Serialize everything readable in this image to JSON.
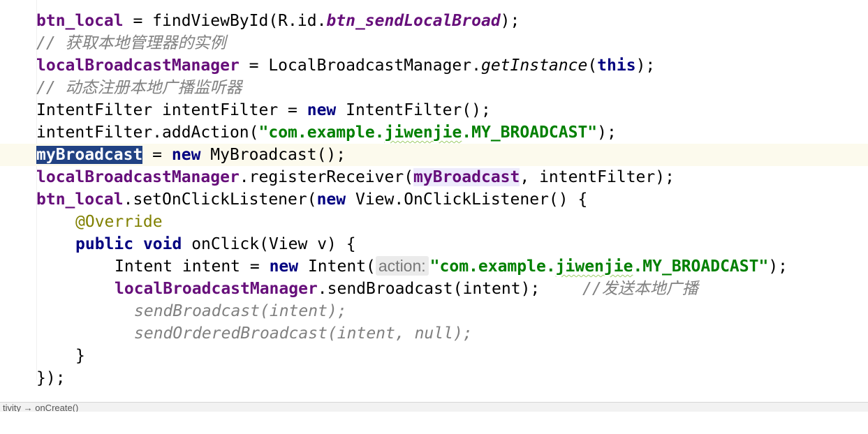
{
  "editor": {
    "lines": {
      "l1": {
        "a": "btn_local",
        "b": " = findViewById(R.id.",
        "c": "btn_sendLocalBroad",
        "d": ");"
      },
      "l2": {
        "comment": "// 获取本地管理器的实例"
      },
      "l3": {
        "a": "localBroadcastManager",
        "b": " = LocalBroadcastManager.",
        "c": "getInstance",
        "d": "(",
        "e": "this",
        "f": ");"
      },
      "l4": {
        "comment": "// 动态注册本地广播监听器"
      },
      "l5": {
        "a": "IntentFilter intentFilter = ",
        "b": "new",
        "c": " IntentFilter();"
      },
      "l6": {
        "a": "intentFilter.addAction(",
        "b1": "\"com.example.",
        "b2": "jiwenjie",
        "b3": ".MY_BROADCAST\"",
        "c": ");"
      },
      "l7": {
        "a": "myBroadcast",
        "b": " = ",
        "c": "new",
        "d": " MyBroadcast();"
      },
      "l8": {
        "a": "localBroadcastManager",
        "b": ".registerReceiver(",
        "c": "myBroadcast",
        "d": ", intentFilter);"
      },
      "l9": {
        "a": "btn_local",
        "b": ".setOnClickListener(",
        "c": "new",
        "d": " View.OnClickListener() {"
      },
      "l10": {
        "a": "@Override"
      },
      "l11": {
        "a": "public",
        "b": " ",
        "c": "void",
        "d": " onClick(View v) {"
      },
      "l12": {
        "a": "Intent intent = ",
        "b": "new",
        "c": " Intent(",
        "hint": "action:",
        "d1": "\"com.example.",
        "d2": "jiwenjie",
        "d3": ".MY_BROADCAST\"",
        "e": ");"
      },
      "l13": {
        "a": "localBroadcastManager",
        "b": ".sendBroadcast(intent);",
        "comment": "//发送本地广播"
      },
      "l14": {
        "comment": "sendBroadcast(intent);"
      },
      "l15": {
        "comment": "sendOrderedBroadcast(intent, null);"
      },
      "l16": {
        "a": "}"
      },
      "l17": {
        "a": "});"
      }
    }
  },
  "status": {
    "text": "tivity → onCreate()"
  },
  "colors": {
    "keyword": "#000080",
    "field": "#660e7a",
    "string": "#008000",
    "comment": "#808080",
    "annotation": "#808000",
    "selection": "#214283",
    "current_line": "#fcfaed"
  }
}
